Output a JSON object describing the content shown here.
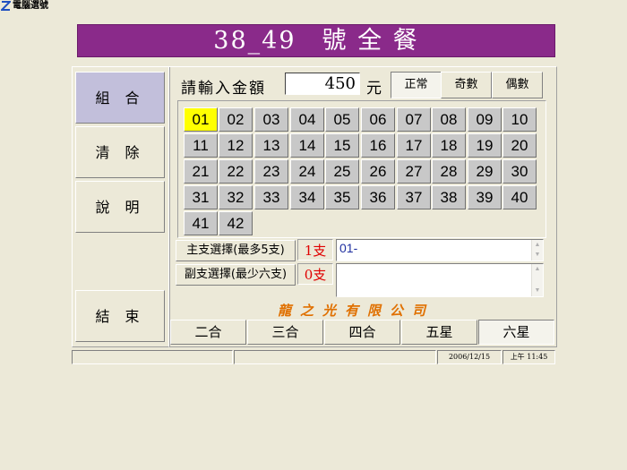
{
  "window": {
    "title": "電腦選號"
  },
  "banner": {
    "title": "38_49　號 全 餐"
  },
  "left_buttons": {
    "combo": "組 合",
    "clear": "清 除",
    "help": "說 明",
    "end": "結 束"
  },
  "amount": {
    "label": "請輸入金額",
    "value": "450",
    "unit": "元"
  },
  "modes": {
    "normal": "正常",
    "odd": "奇數",
    "even": "偶數"
  },
  "numbers": [
    "01",
    "02",
    "03",
    "04",
    "05",
    "06",
    "07",
    "08",
    "09",
    "10",
    "11",
    "12",
    "13",
    "14",
    "15",
    "16",
    "17",
    "18",
    "19",
    "20",
    "21",
    "22",
    "23",
    "24",
    "25",
    "26",
    "27",
    "28",
    "29",
    "30",
    "31",
    "32",
    "33",
    "34",
    "35",
    "36",
    "37",
    "38",
    "39",
    "40",
    "41",
    "42"
  ],
  "selected_numbers": [
    "01"
  ],
  "main_select": {
    "label": "主支選擇(最多5支)",
    "count": "1支",
    "value": "01-"
  },
  "sub_select": {
    "label": "副支選擇(最少六支)",
    "count": "0支",
    "value": ""
  },
  "company": "龍之光有限公司",
  "tabs": [
    "二合",
    "三合",
    "四合",
    "五星",
    "六星"
  ],
  "active_tab": "六星",
  "status": {
    "date": "2006/12/15",
    "time": "上午 11:45"
  },
  "colors": {
    "banner": "#8a2a8a",
    "selected_number": "#ffff00",
    "count_text": "#e00000",
    "company_text": "#e07000"
  }
}
